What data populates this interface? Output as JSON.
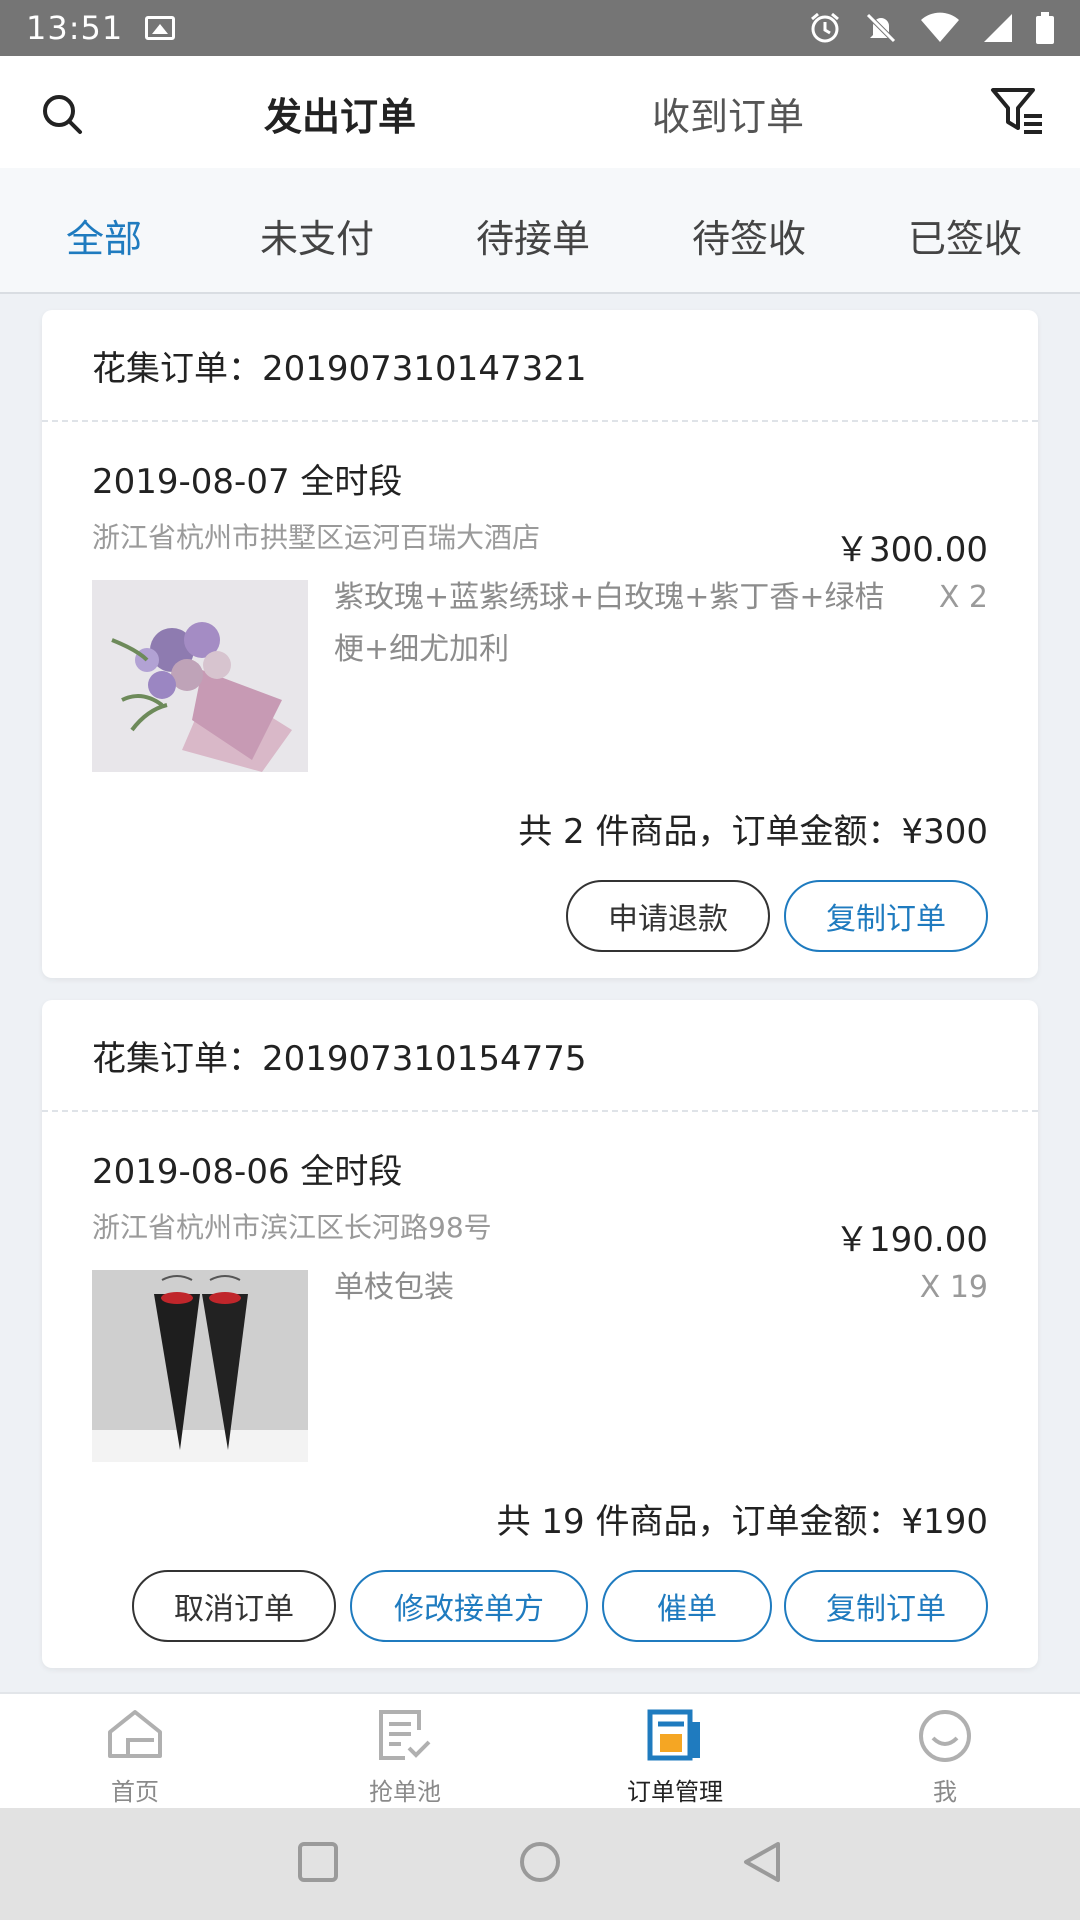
{
  "status_bar": {
    "time": "13:51"
  },
  "top_nav": {
    "tab_sent": "发出订单",
    "tab_received": "收到订单"
  },
  "sub_tabs": [
    "全部",
    "未支付",
    "待接单",
    "待签收",
    "已签收"
  ],
  "orders": [
    {
      "header": "花集订单：201907310147321",
      "date": "2019-08-07 全时段",
      "address": "浙江省杭州市拱墅区运河百瑞大酒店",
      "price": "￥300.00",
      "product_line1": "紫玫瑰+蓝紫绣球+白玫瑰+紫丁香+绿桔",
      "product_line2": "梗+细尤加利",
      "qty": "X 2",
      "summary": "共 2 件商品，订单金额：¥300",
      "buttons": [
        "申请退款",
        "复制订单"
      ]
    },
    {
      "header": "花集订单：201907310154775",
      "date": "2019-08-06 全时段",
      "address": "浙江省杭州市滨江区长河路98号",
      "price": "￥190.00",
      "product_line1": "单枝包装",
      "qty": "X 19",
      "summary": "共 19 件商品，订单金额：¥190",
      "buttons": [
        "取消订单",
        "修改接单方",
        "催单",
        "复制订单"
      ]
    }
  ],
  "bottom_nav": [
    "首页",
    "抢单池",
    "订单管理",
    "我"
  ],
  "colors": {
    "accent": "#1f7bbf",
    "active_icon": "#1f7bbf",
    "icon_orange": "#f5a623"
  }
}
